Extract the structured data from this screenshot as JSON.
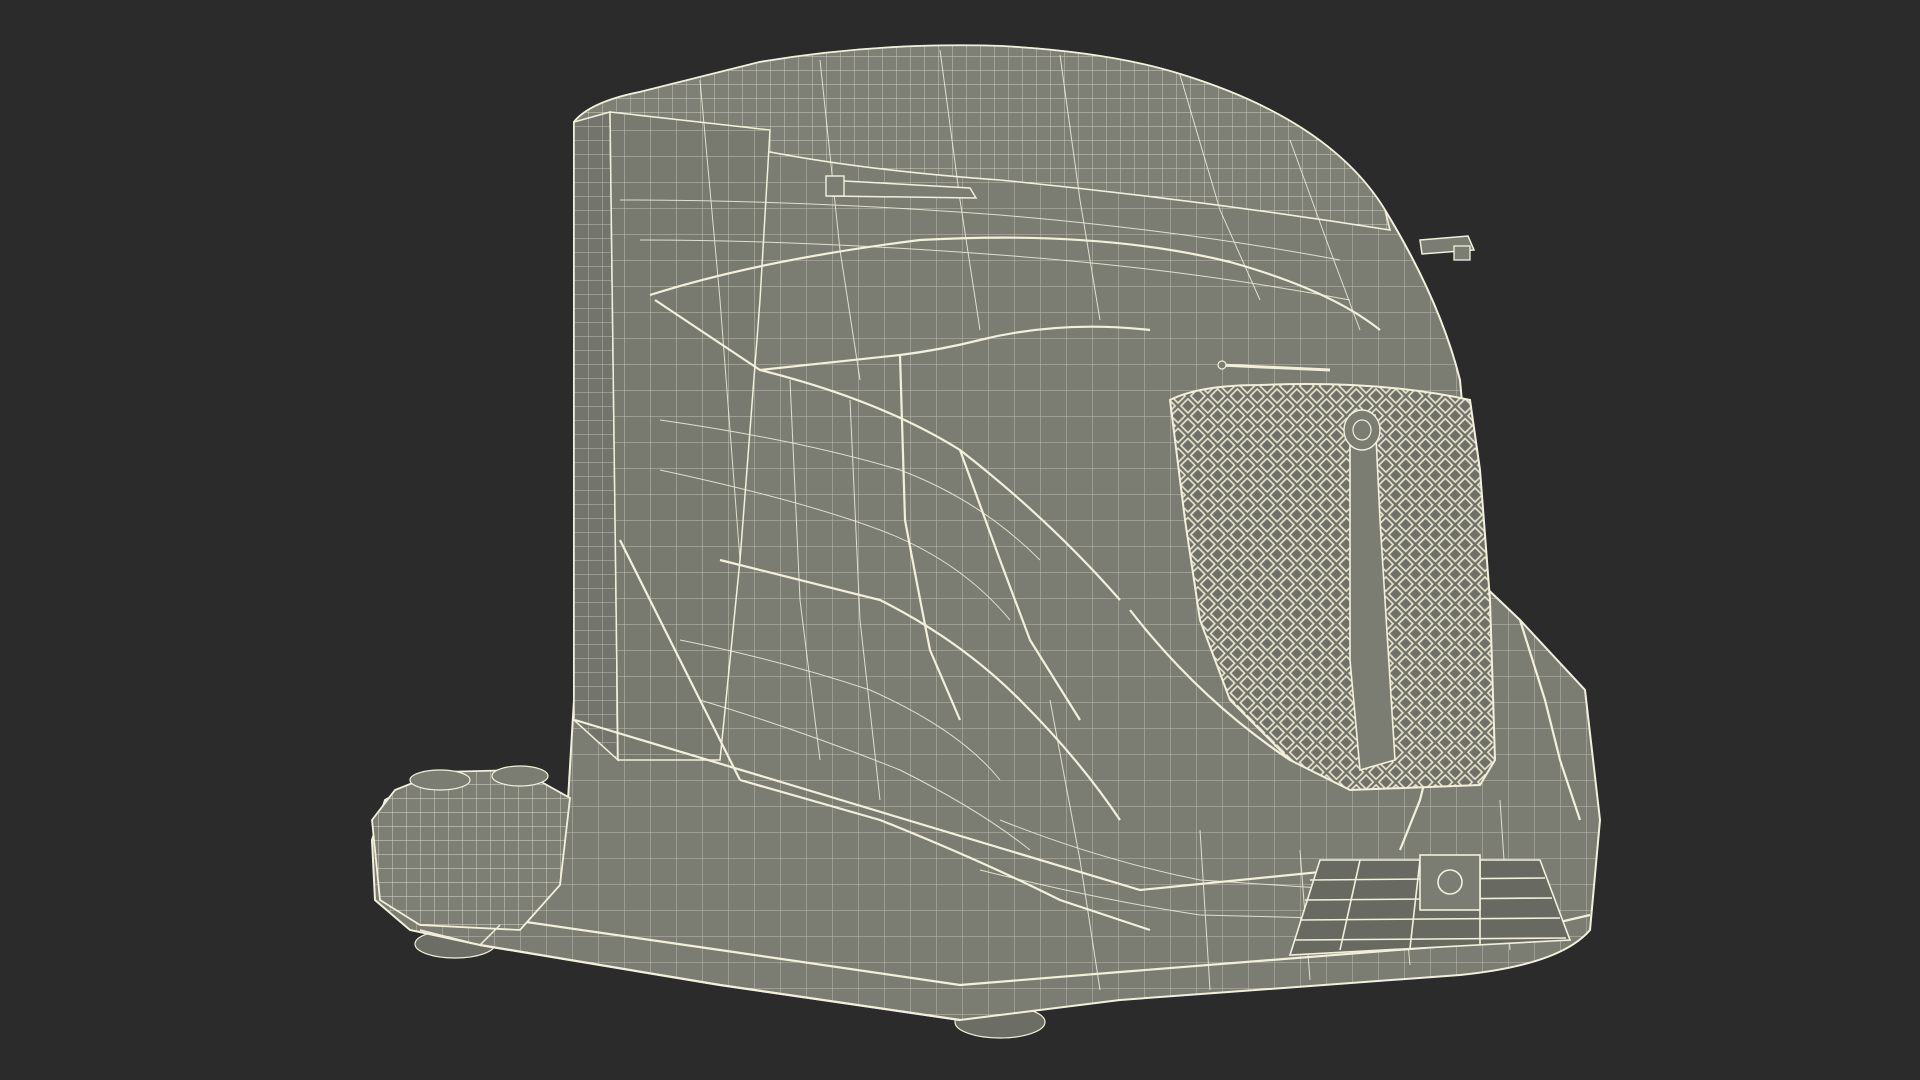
{
  "scene": {
    "subject": "truck-cab-wireframe",
    "background_color": "#2b2b2b",
    "surface_color": "#7b7d73",
    "surface_shadow_color": "#6a6c63",
    "wire_color": "#f2f0dc",
    "mesh_color": "#ece8d2"
  }
}
